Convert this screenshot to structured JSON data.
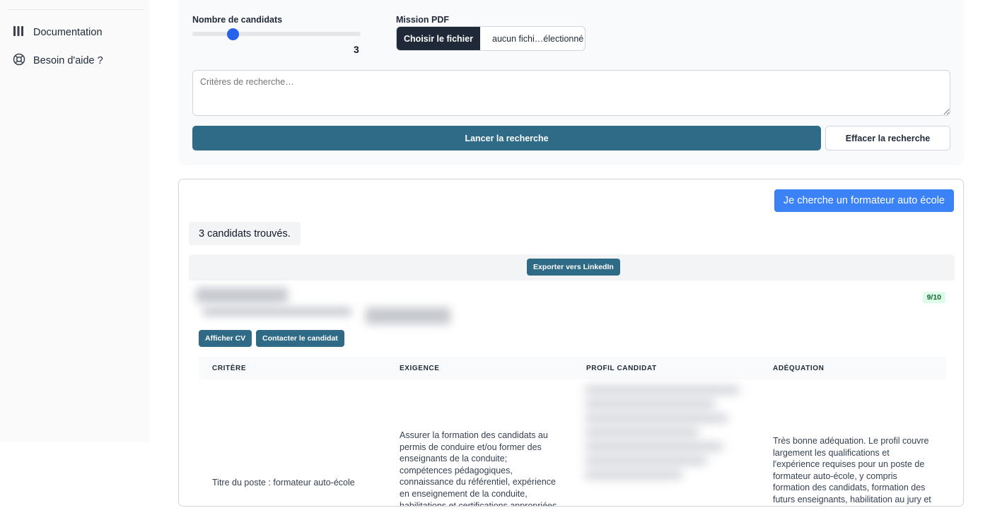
{
  "sidebar": {
    "items": [
      {
        "label": "Documentation",
        "icon": "library-icon"
      },
      {
        "label": "Besoin d'aide ?",
        "icon": "lifebuoy-icon"
      }
    ]
  },
  "search": {
    "candidates_label": "Nombre de candidats",
    "candidates_value": "3",
    "candidates_fraction": 0.24,
    "pdf_label": "Mission PDF",
    "file_button": "Choisir le fichier",
    "file_status": "aucun fichi…électionné",
    "criteria_placeholder": "Critères de recherche…",
    "launch_label": "Lancer la recherche",
    "clear_label": "Effacer la recherche"
  },
  "results": {
    "query_bubble": "Je cherche un formateur auto école",
    "count_text": "3 candidats trouvés.",
    "export_label": "Exporter vers LinkedIn",
    "candidate": {
      "score": "9/10",
      "view_cv_label": "Afficher CV",
      "contact_label": "Contacter le candidat"
    },
    "table": {
      "headers": [
        "CRITÈRE",
        "EXIGENCE",
        "PROFIL CANDIDAT",
        "ADÉQUATION"
      ],
      "row": {
        "criterion": "Titre du poste : formateur auto-école",
        "requirement": "Assurer la formation des candidats au permis de conduire et/ou former des enseignants de la conduite; compétences pédagogiques, connaissance du référentiel, expérience en enseignement de la conduite, habilitations et certifications appropriées",
        "adequacy": "Très bonne adéquation. Le profil couvre largement les qualifications et l'expérience requises pour un poste de formateur auto-école, y compris formation des candidats, formation des futurs enseignants, habilitation au jury et"
      }
    }
  },
  "colors": {
    "primary": "#2f6b86",
    "accent_blue": "#3b82f6",
    "slider": "#2563eb",
    "score_bg": "#dcfce7"
  }
}
